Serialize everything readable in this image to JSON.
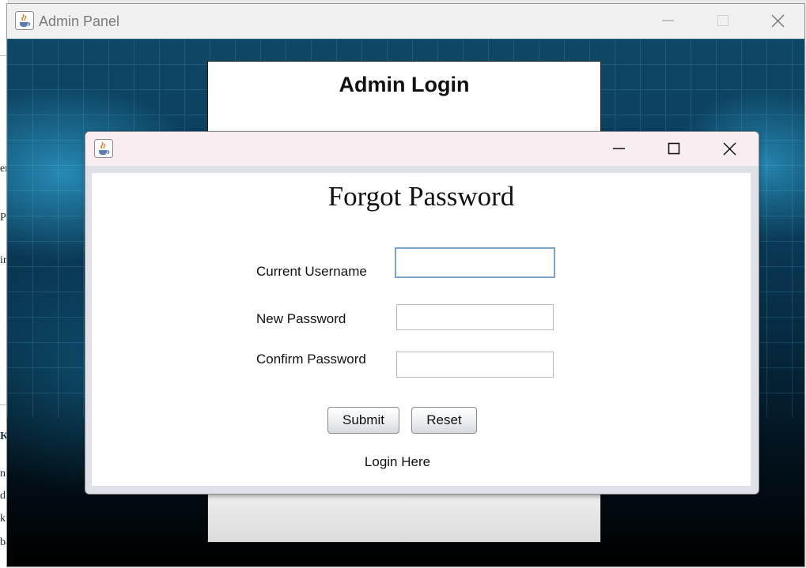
{
  "main_window": {
    "title": "Admin Panel",
    "icon": "java-cup-icon"
  },
  "admin_login": {
    "title": "Admin Login"
  },
  "dialog": {
    "icon": "java-cup-icon",
    "title": "Forgot Password",
    "fields": {
      "username_label": "Current Username",
      "username_value": "",
      "new_password_label": "New Password",
      "new_password_value": "",
      "confirm_password_label": "Confirm Password",
      "confirm_password_value": ""
    },
    "buttons": {
      "submit": "Submit",
      "reset": "Reset"
    },
    "login_link": "Login Here"
  },
  "background_fragments": [
    "en",
    "P",
    "im",
    "Ko",
    "n",
    "d",
    "k",
    "ba"
  ],
  "colors": {
    "dialog_titlebar": "#f8eef1",
    "focus_border": "#7aa3cc"
  }
}
